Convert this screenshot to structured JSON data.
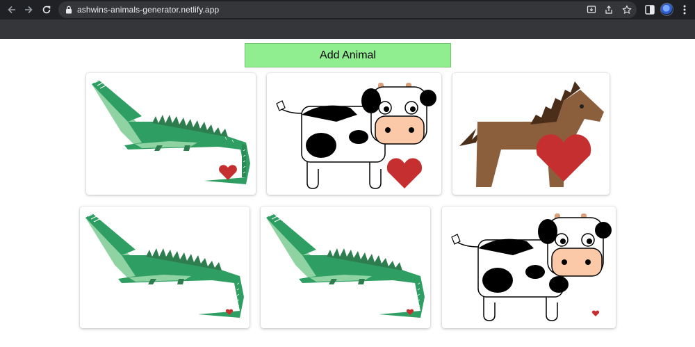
{
  "browser": {
    "url": "ashwins-animals-generator.netlify.app",
    "back_icon": "arrow-left-icon",
    "forward_icon": "arrow-right-icon",
    "refresh_icon": "refresh-icon"
  },
  "page": {
    "add_button_label": "Add Animal",
    "animals": [
      {
        "type": "crocodile",
        "liked": true,
        "heart_size": "medium"
      },
      {
        "type": "cow",
        "liked": true,
        "heart_size": "large"
      },
      {
        "type": "horse",
        "liked": true,
        "heart_size": "large"
      },
      {
        "type": "crocodile",
        "liked": true,
        "heart_size": "small"
      },
      {
        "type": "crocodile",
        "liked": true,
        "heart_size": "small"
      },
      {
        "type": "cow",
        "liked": true,
        "heart_size": "small"
      }
    ],
    "colors": {
      "button_bg": "#90ee90",
      "heart": "#c62f2f",
      "croc_dark": "#2e9e63",
      "croc_light": "#8fd3a3",
      "horse": "#8b5e3c"
    }
  }
}
